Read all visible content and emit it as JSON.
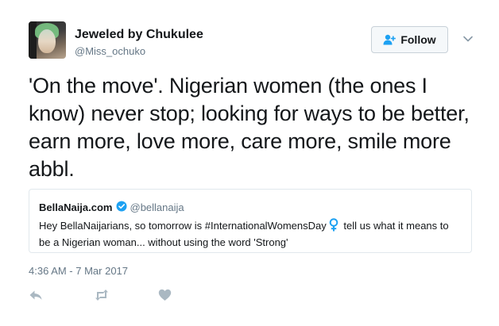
{
  "author": {
    "display_name": "Jeweled by Chukulee",
    "handle": "@Miss_ochuko",
    "avatar_icon": "profile-photo"
  },
  "follow_button": {
    "label": "Follow",
    "icon": "add-user-icon"
  },
  "menu_icon": "chevron-down-icon",
  "tweet": {
    "text": "'On the move'. Nigerian women (the ones I know) never stop; looking for ways to be better, earn more, love more, care more, smile more abbl."
  },
  "quoted_tweet": {
    "display_name": "BellaNaija.com",
    "verified_icon": "verified-badge-icon",
    "handle": "@bellanaija",
    "text_before": "Hey BellaNaijarians, so tomorrow is #InternationalWomensDay",
    "emoji_icon": "female-sign-icon",
    "text_after": "tell us what it means to be a Nigerian woman... without using the word 'Strong'"
  },
  "timestamp": "4:36 AM - 7 Mar 2017",
  "actions": [
    {
      "name": "reply",
      "icon": "reply-icon"
    },
    {
      "name": "retweet",
      "icon": "retweet-icon"
    },
    {
      "name": "like",
      "icon": "heart-icon"
    }
  ],
  "colors": {
    "text_primary": "#14171a",
    "text_secondary": "#657786",
    "border": "#e1e8ed",
    "verified_blue": "#1da1f2",
    "female_sign": "#1da1f2",
    "action_icon": "#aab8c2",
    "follow_bg": "#f5f8fa"
  }
}
